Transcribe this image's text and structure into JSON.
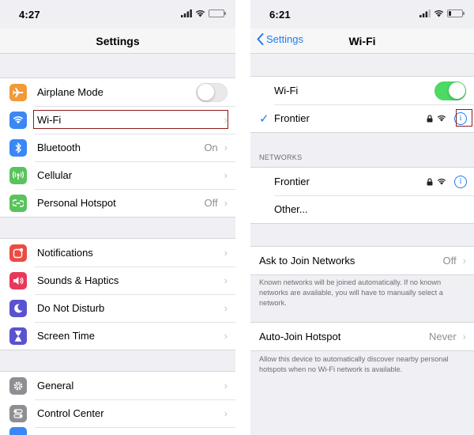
{
  "left": {
    "status_time": "4:27",
    "nav_title": "Settings",
    "group1": [
      {
        "label": "Airplane Mode",
        "value": "",
        "icon": "airplane-icon",
        "color": "#f19a37",
        "control": "toggle-off"
      },
      {
        "label": "Wi-Fi",
        "value": "",
        "icon": "wifi-icon",
        "color": "#3b87f5",
        "control": "chevron"
      },
      {
        "label": "Bluetooth",
        "value": "On",
        "icon": "bluetooth-icon",
        "color": "#3b87f5",
        "control": "chevron"
      },
      {
        "label": "Cellular",
        "value": "",
        "icon": "cellular-icon",
        "color": "#5ac35d",
        "control": "chevron"
      },
      {
        "label": "Personal Hotspot",
        "value": "Off",
        "icon": "hotspot-icon",
        "color": "#5ac35d",
        "control": "chevron"
      }
    ],
    "group2": [
      {
        "label": "Notifications",
        "icon": "notifications-icon",
        "color": "#ea4c44"
      },
      {
        "label": "Sounds & Haptics",
        "icon": "speaker-icon",
        "color": "#e8395a"
      },
      {
        "label": "Do Not Disturb",
        "icon": "moon-icon",
        "color": "#5a53d0"
      },
      {
        "label": "Screen Time",
        "icon": "hourglass-icon",
        "color": "#5a53d0"
      }
    ],
    "group3": [
      {
        "label": "General",
        "icon": "gear-icon",
        "color": "#8e8e93"
      },
      {
        "label": "Control Center",
        "icon": "toggles-icon",
        "color": "#8e8e93"
      }
    ]
  },
  "right": {
    "status_time": "6:21",
    "back_label": "Settings",
    "nav_title": "Wi-Fi",
    "wifi_label": "Wi-Fi",
    "connected_network": "Frontier",
    "networks_header": "NETWORKS",
    "networks": [
      "Frontier"
    ],
    "other_label": "Other...",
    "ask_label": "Ask to Join Networks",
    "ask_value": "Off",
    "ask_note": "Known networks will be joined automatically. If no known networks are available, you will have to manually select a network.",
    "autojoin_label": "Auto-Join Hotspot",
    "autojoin_value": "Never",
    "autojoin_note": "Allow this device to automatically discover nearby personal hotspots when no Wi-Fi network is available."
  },
  "colors": {
    "accent": "#1d7bf5",
    "toggle_on": "#4cd964",
    "highlight": "#8b1a1a"
  }
}
